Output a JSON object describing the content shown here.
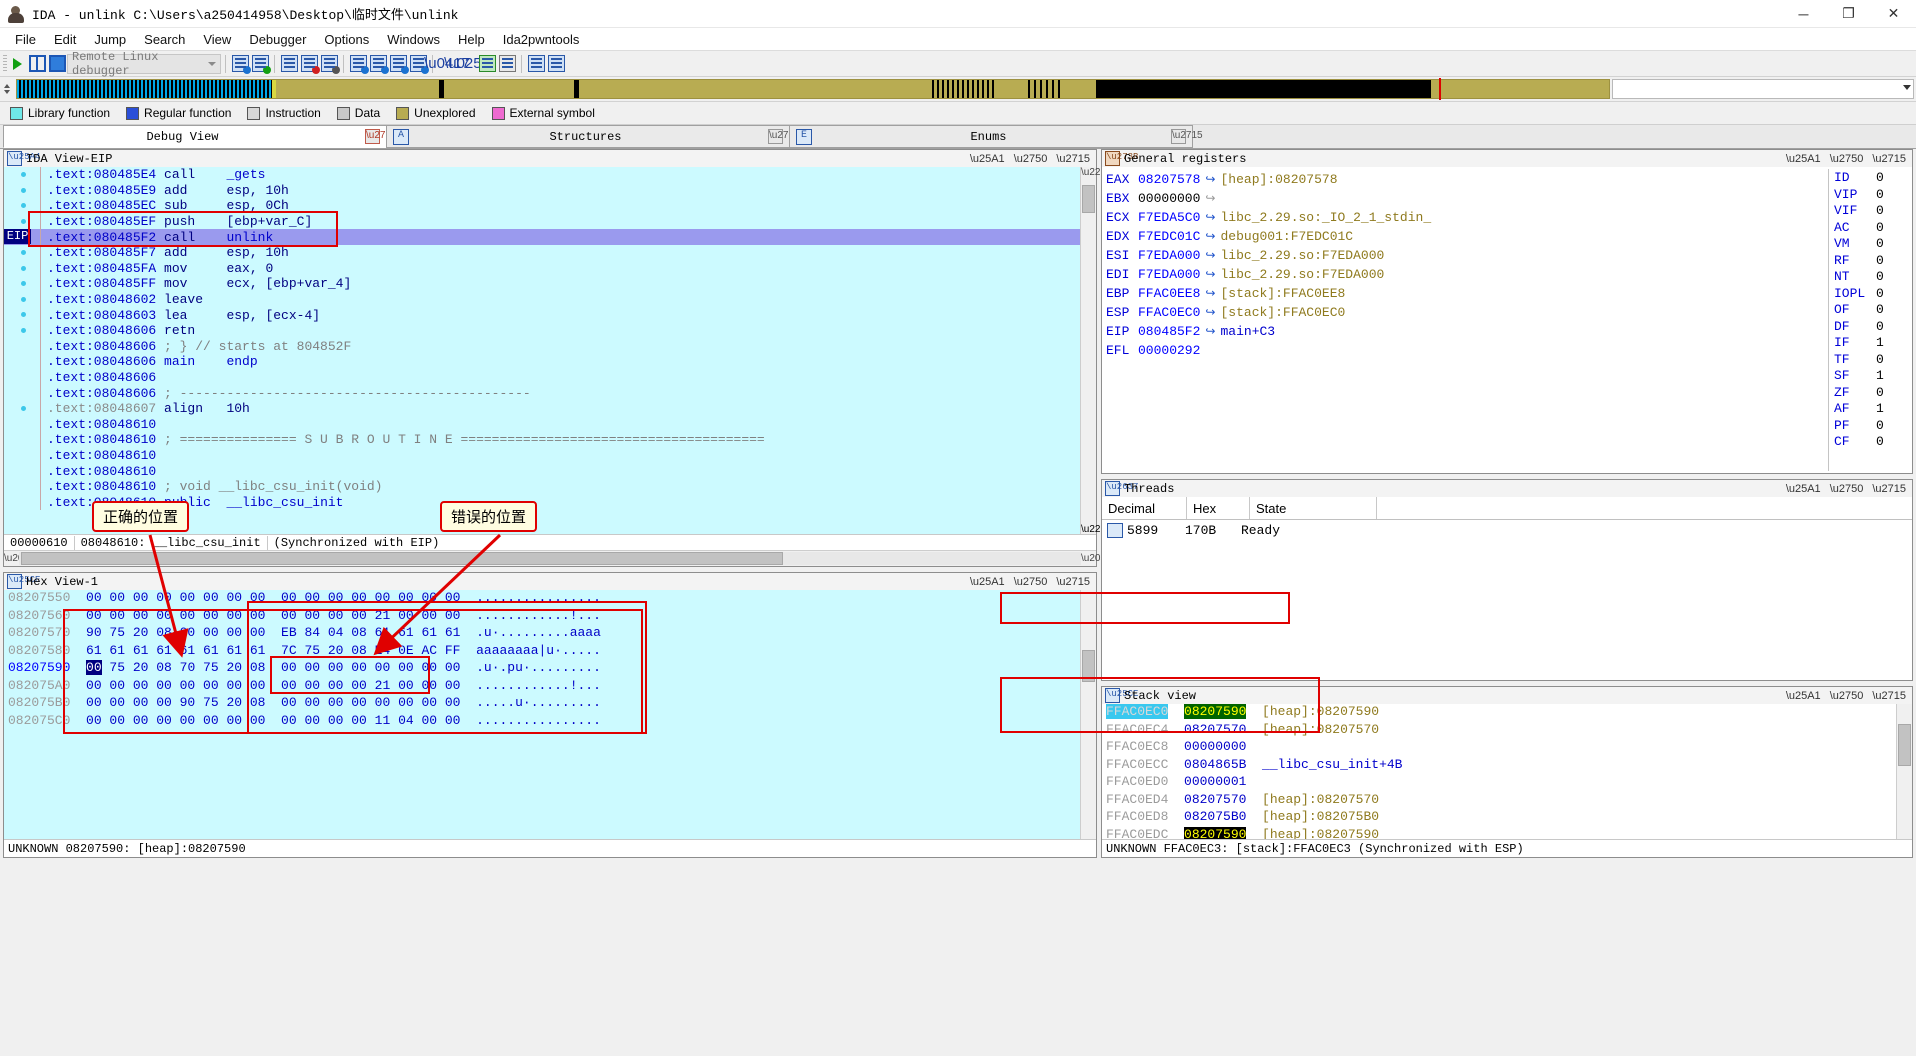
{
  "window": {
    "title": "IDA - unlink C:\\Users\\a250414958\\Desktop\\临时文件\\unlink",
    "minimize": "─",
    "maximize": "❐",
    "close": "✕"
  },
  "menu": [
    "File",
    "Edit",
    "Jump",
    "Search",
    "View",
    "Debugger",
    "Options",
    "Windows",
    "Help",
    "Ida2pwntools"
  ],
  "toolbar": {
    "debugger_select": "Remote Linux debugger"
  },
  "legend": [
    {
      "label": "Library function",
      "color": "#6fe8e8"
    },
    {
      "label": "Regular function",
      "color": "#2b4fd8"
    },
    {
      "label": "Instruction",
      "color": "#d8d8d8"
    },
    {
      "label": "Data",
      "color": "#c8c8c8"
    },
    {
      "label": "Unexplored",
      "color": "#b8ac52"
    },
    {
      "label": "External symbol",
      "color": "#ee6ad0"
    }
  ],
  "doc_tabs": [
    {
      "label": "Debug View",
      "active": true,
      "closable": true
    },
    {
      "label": "Structures",
      "active": false,
      "closable": true,
      "icon": "A"
    },
    {
      "label": "Enums",
      "active": false,
      "closable": true,
      "icon": "E"
    }
  ],
  "disassembly": {
    "title": "IDA View-EIP",
    "eip_badge": "EIP",
    "lines": [
      {
        "addr": ".text:080485E4",
        "mnem": "call",
        "ops": "_gets",
        "dot": true,
        "opcls": "fn"
      },
      {
        "addr": ".text:080485E9",
        "mnem": "add",
        "ops": "esp, 10h",
        "dot": true
      },
      {
        "addr": ".text:080485EC",
        "mnem": "sub",
        "ops": "esp, 0Ch",
        "dot": true
      },
      {
        "addr": ".text:080485EF",
        "mnem": "push",
        "ops": "[ebp+var_C]",
        "dot": true
      },
      {
        "addr": ".text:080485F2",
        "mnem": "call",
        "ops": "unlink",
        "dot": false,
        "highlight": true,
        "eip": true,
        "opcls": "fn"
      },
      {
        "addr": ".text:080485F7",
        "mnem": "add",
        "ops": "esp, 10h",
        "dot": true
      },
      {
        "addr": ".text:080485FA",
        "mnem": "mov",
        "ops": "eax, 0",
        "dot": true
      },
      {
        "addr": ".text:080485FF",
        "mnem": "mov",
        "ops": "ecx, [ebp+var_4]",
        "dot": true
      },
      {
        "addr": ".text:08048602",
        "mnem": "leave",
        "ops": "",
        "dot": true
      },
      {
        "addr": ".text:08048603",
        "mnem": "lea",
        "ops": "esp, [ecx-4]",
        "dot": true
      },
      {
        "addr": ".text:08048606",
        "mnem": "retn",
        "ops": "",
        "dot": true
      },
      {
        "addr": ".text:08048606",
        "mnem": "",
        "ops": "; } // starts at 804852F",
        "dot": false,
        "comment": true
      },
      {
        "addr": ".text:08048606",
        "mnem": "main",
        "ops": "endp",
        "dot": false,
        "namecls": true
      },
      {
        "addr": ".text:08048606",
        "mnem": "",
        "ops": "",
        "dot": false
      },
      {
        "addr": ".text:08048606",
        "mnem": "",
        "ops": "; ---------------------------------------------",
        "dot": false,
        "comment": true
      },
      {
        "addr": ".text:08048607",
        "mnem": "align",
        "ops": "10h",
        "dot": true,
        "dim": true
      },
      {
        "addr": ".text:08048610",
        "mnem": "",
        "ops": "",
        "dot": false
      },
      {
        "addr": ".text:08048610",
        "mnem": "",
        "ops": "; =============== S U B R O U T I N E =======================================",
        "dot": false,
        "comment": true
      },
      {
        "addr": ".text:08048610",
        "mnem": "",
        "ops": "",
        "dot": false
      },
      {
        "addr": ".text:08048610",
        "mnem": "",
        "ops": "",
        "dot": false
      },
      {
        "addr": ".text:08048610",
        "mnem": "",
        "ops": "; void __libc_csu_init(void)",
        "dot": false,
        "comment": true
      },
      {
        "addr": ".text:08048610",
        "mnem": "public",
        "ops": "__libc_csu_init",
        "dot": false,
        "namecls": true
      }
    ],
    "status": [
      "00000610",
      "08048610: __libc_csu_init",
      "(Synchronized with EIP)"
    ]
  },
  "hexview": {
    "title": "Hex View-1",
    "rows": [
      {
        "addr": "08207550",
        "bytes": "00 00 00 00 00 00 00 00  00 00 00 00 00 00 00 00",
        "ascii": "................"
      },
      {
        "addr": "08207560",
        "bytes": "00 00 00 00 00 00 00 00  00 00 00 00 21 00 00 00",
        "ascii": "............!..."
      },
      {
        "addr": "08207570",
        "bytes": "90 75 20 08 00 00 00 00  EB 84 04 08 61 61 61 61",
        "ascii": ".u·.........aaaa"
      },
      {
        "addr": "08207580",
        "bytes": "61 61 61 61 61 61 61 61  7C 75 20 08 E4 0E AC FF",
        "ascii": "aaaaaaaa|u·....."
      },
      {
        "addr": "08207590",
        "bytes": "00 75 20 08 70 75 20 08  00 00 00 00 00 00 00 00",
        "ascii": ".u·.pu·.........",
        "current": true,
        "sel_start": 0,
        "sel_len": 2
      },
      {
        "addr": "082075A0",
        "bytes": "00 00 00 00 00 00 00 00  00 00 00 00 21 00 00 00",
        "ascii": "............!..."
      },
      {
        "addr": "082075B0",
        "bytes": "00 00 00 00 90 75 20 08  00 00 00 00 00 00 00 00",
        "ascii": ".....u·........."
      },
      {
        "addr": "082075C0",
        "bytes": "00 00 00 00 00 00 00 00  00 00 00 00 11 04 00 00",
        "ascii": "................"
      }
    ],
    "status": "UNKNOWN 08207590: [heap]:08207590"
  },
  "registers": {
    "title": "General registers",
    "rows": [
      {
        "name": "EAX",
        "value": "08207578",
        "arrow": true,
        "comment": "[heap]:08207578",
        "ccls": "gold"
      },
      {
        "name": "EBX",
        "value": "00000000",
        "arrow": true,
        "gray": true,
        "comment": "",
        "zero": true
      },
      {
        "name": "ECX",
        "value": "F7EDA5C0",
        "arrow": true,
        "comment": "libc_2.29.so:_IO_2_1_stdin_",
        "ccls": "gold"
      },
      {
        "name": "EDX",
        "value": "F7EDC01C",
        "arrow": true,
        "comment": "debug001:F7EDC01C",
        "ccls": "gold"
      },
      {
        "name": "ESI",
        "value": "F7EDA000",
        "arrow": true,
        "comment": "libc_2.29.so:F7EDA000",
        "ccls": "gold"
      },
      {
        "name": "EDI",
        "value": "F7EDA000",
        "arrow": true,
        "comment": "libc_2.29.so:F7EDA000",
        "ccls": "gold"
      },
      {
        "name": "EBP",
        "value": "FFAC0EE8",
        "arrow": true,
        "comment": "[stack]:FFAC0EE8",
        "ccls": "gold"
      },
      {
        "name": "ESP",
        "value": "FFAC0EC0",
        "arrow": true,
        "comment": "[stack]:FFAC0EC0",
        "ccls": "gold"
      },
      {
        "name": "EIP",
        "value": "080485F2",
        "arrow": true,
        "comment": "main+C3",
        "ccls": "blue"
      },
      {
        "name": "EFL",
        "value": "00000292",
        "arrow": false,
        "comment": ""
      }
    ],
    "flags": [
      {
        "name": "ID",
        "value": "0"
      },
      {
        "name": "VIP",
        "value": "0"
      },
      {
        "name": "VIF",
        "value": "0"
      },
      {
        "name": "AC",
        "value": "0"
      },
      {
        "name": "VM",
        "value": "0"
      },
      {
        "name": "RF",
        "value": "0"
      },
      {
        "name": "NT",
        "value": "0"
      },
      {
        "name": "IOPL",
        "value": "0"
      },
      {
        "name": "OF",
        "value": "0"
      },
      {
        "name": "DF",
        "value": "0"
      },
      {
        "name": "IF",
        "value": "1"
      },
      {
        "name": "TF",
        "value": "0"
      },
      {
        "name": "SF",
        "value": "1"
      },
      {
        "name": "ZF",
        "value": "0"
      },
      {
        "name": "AF",
        "value": "1"
      },
      {
        "name": "PF",
        "value": "0"
      },
      {
        "name": "CF",
        "value": "0"
      }
    ]
  },
  "threads": {
    "title": "Threads",
    "columns": [
      "Decimal",
      "Hex",
      "State"
    ],
    "rows": [
      {
        "decimal": "5899",
        "hex": "170B",
        "state": "Ready"
      }
    ]
  },
  "stackview": {
    "title": "Stack view",
    "rows": [
      {
        "addr": "FFAC0EC0",
        "value": "08207590",
        "comment": "[heap]:08207590",
        "current": true,
        "ccls": "gold"
      },
      {
        "addr": "FFAC0EC4",
        "value": "08207570",
        "comment": "[heap]:08207570",
        "ccls": "gold"
      },
      {
        "addr": "FFAC0EC8",
        "value": "00000000",
        "comment": "",
        "ccls": "gold"
      },
      {
        "addr": "FFAC0ECC",
        "value": "0804865B",
        "comment": "__libc_csu_init+4B",
        "ccls": "blue"
      },
      {
        "addr": "FFAC0ED0",
        "value": "00000001",
        "comment": "",
        "ccls": "gold"
      },
      {
        "addr": "FFAC0ED4",
        "value": "08207570",
        "comment": "[heap]:08207570",
        "ccls": "gold"
      },
      {
        "addr": "FFAC0ED8",
        "value": "082075B0",
        "comment": "[heap]:082075B0",
        "ccls": "gold"
      },
      {
        "addr": "FFAC0EDC",
        "value": "08207590",
        "comment": "[heap]:08207590",
        "highlight_value": true,
        "ccls": "gold"
      }
    ],
    "status": "UNKNOWN FFAC0EC3: [stack]:FFAC0EC3 (Synchronized with ESP)"
  },
  "annotations": {
    "correct_label": "正确的位置",
    "wrong_label": "错误的位置",
    "accent_color": "#e00000"
  }
}
